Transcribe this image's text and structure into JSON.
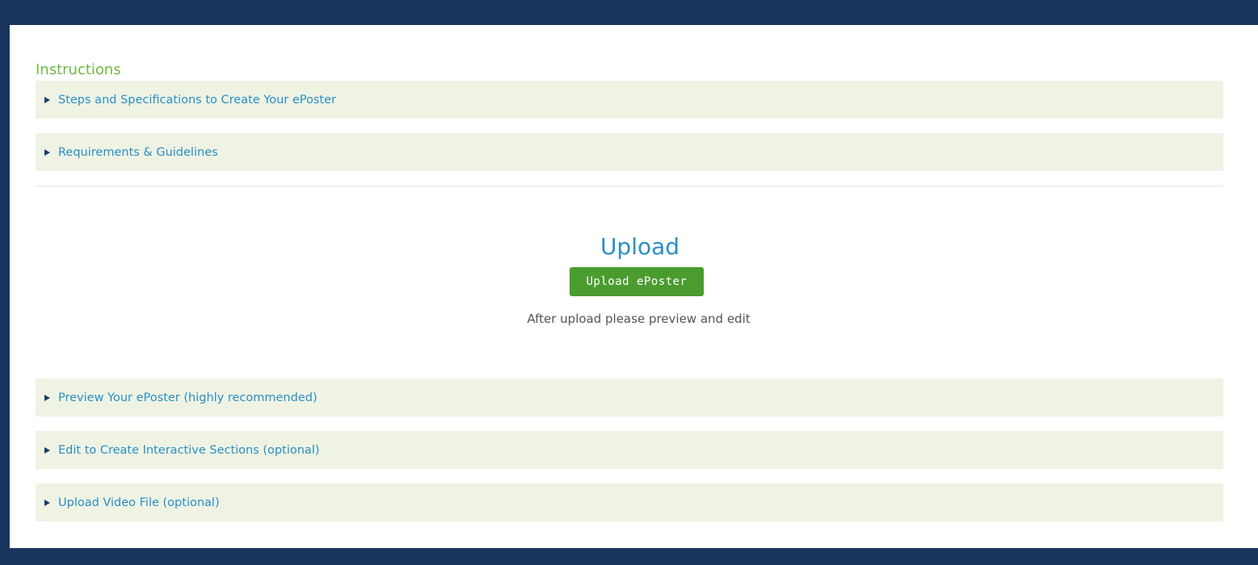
{
  "instructions": {
    "heading": "Instructions",
    "sections": [
      {
        "label": "Steps and Specifications to Create Your ePoster"
      },
      {
        "label": "Requirements & Guidelines"
      }
    ]
  },
  "upload": {
    "title": "Upload",
    "button_label": "Upload ePoster",
    "hint": "After upload please preview and edit"
  },
  "post_upload": {
    "sections": [
      {
        "label": "Preview Your ePoster (highly recommended)"
      },
      {
        "label": "Edit to Create Interactive Sections (optional)"
      },
      {
        "label": "Upload Video File (optional)"
      }
    ]
  },
  "colors": {
    "frame": "#1a365f",
    "heading_green": "#6dbb45",
    "link_blue": "#2a8fc6",
    "accordion_bg": "#eff3e4",
    "button_green": "#4a9c2f"
  },
  "icons": {
    "accordion_toggle": "caret-right-icon"
  }
}
